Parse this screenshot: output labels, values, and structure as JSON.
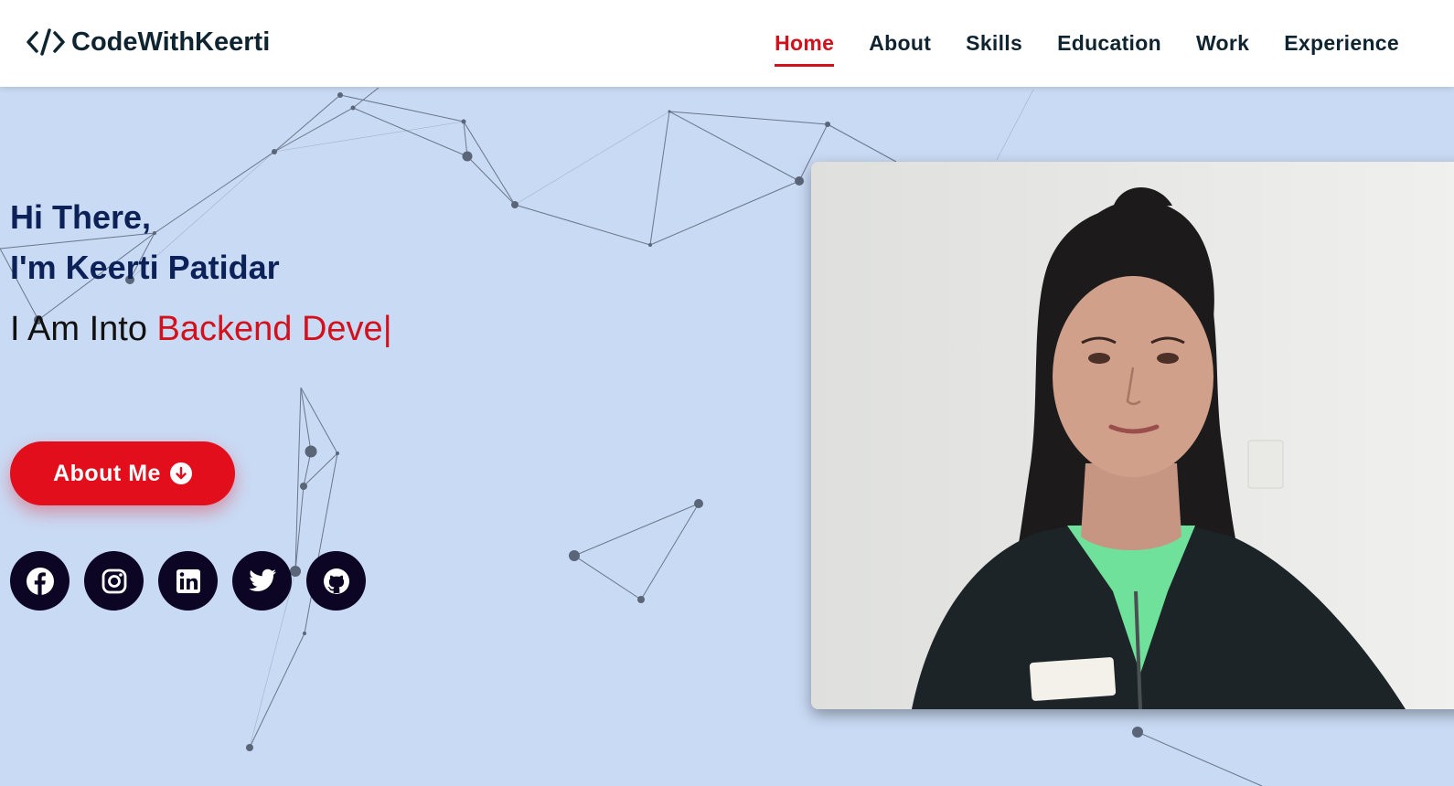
{
  "header": {
    "logo_text": "CodeWithKeerti",
    "logo_icon": "code-brackets-icon",
    "nav": [
      {
        "label": "Home",
        "active": true
      },
      {
        "label": "About",
        "active": false
      },
      {
        "label": "Skills",
        "active": false
      },
      {
        "label": "Education",
        "active": false
      },
      {
        "label": "Work",
        "active": false
      },
      {
        "label": "Experience",
        "active": false
      }
    ]
  },
  "hero": {
    "greeting_line1": "Hi There,",
    "greeting_line2": "I'm Keerti Patidar",
    "typed_prefix": "I Am Into ",
    "typed_role": "Backend Deve",
    "cursor": "|",
    "about_button_label": "About Me",
    "about_button_icon": "arrow-down-circle-icon",
    "socials": [
      {
        "name": "facebook",
        "icon": "facebook-icon"
      },
      {
        "name": "instagram",
        "icon": "instagram-icon"
      },
      {
        "name": "linkedin",
        "icon": "linkedin-icon"
      },
      {
        "name": "twitter",
        "icon": "twitter-icon"
      },
      {
        "name": "github",
        "icon": "github-icon"
      }
    ],
    "photo": "profile-photo"
  },
  "colors": {
    "background": "#c9daf4",
    "accent": "#d2111c",
    "button": "#e30e1c",
    "heading": "#0b2158",
    "nav_text": "#0e2431",
    "social_bg": "#0d0524"
  }
}
